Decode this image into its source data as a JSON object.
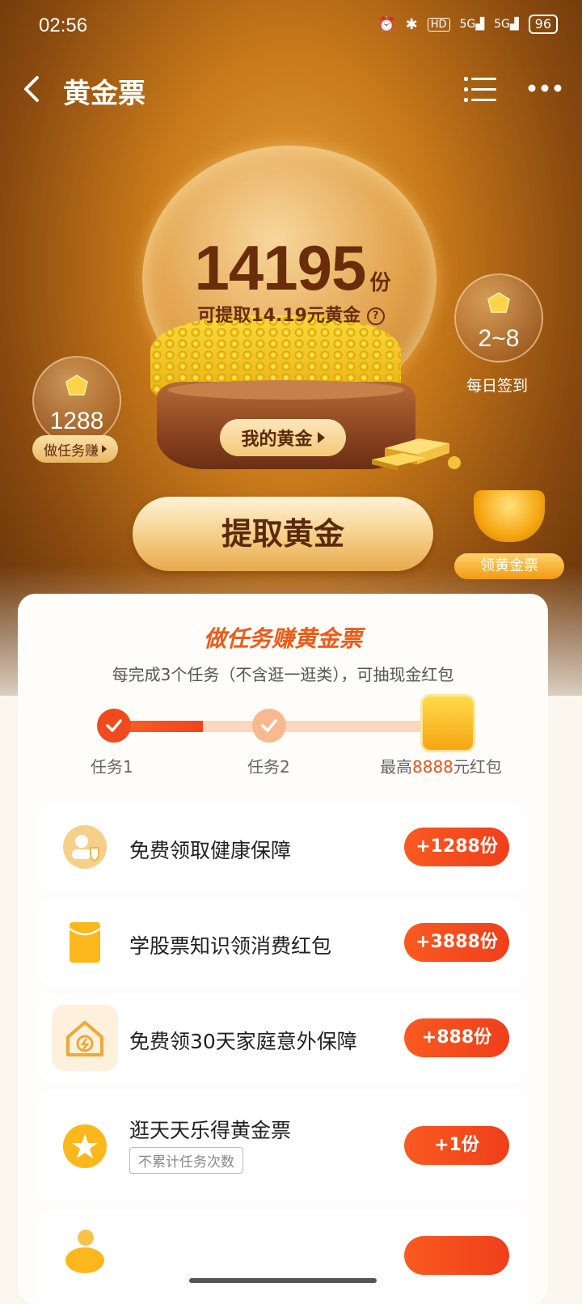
{
  "status_bar": {
    "time": "02:56",
    "hd": "HD",
    "signal1": "5G",
    "signal2": "5G",
    "battery": "96"
  },
  "nav": {
    "title": "黄金票"
  },
  "gold": {
    "amount": "14195",
    "unit": "份",
    "withdrawable": "可提取14.19元黄金",
    "help": "?",
    "my_gold_label": "我的黄金"
  },
  "bubbles": {
    "task": {
      "value": "1288",
      "label": "做任务赚"
    },
    "signin": {
      "value": "2~8",
      "label": "每日签到"
    }
  },
  "withdraw_label": "提取黄金",
  "claim_ticket_label": "领黄金票",
  "tasks_card": {
    "title": "做任务赚黄金票",
    "subtitle": "每完成3个任务（不含逛一逛类），可抽现金红包",
    "progress": {
      "completed_fraction": 0.27
    },
    "steps": [
      "任务1",
      "任务2"
    ],
    "max_prefix": "最高",
    "max_amount": "8888",
    "max_suffix": "元红包"
  },
  "tasks": [
    {
      "name": "免费领取健康保障",
      "reward": "+1288份",
      "icon": "health-shield-icon"
    },
    {
      "name": "学股票知识领消费红包",
      "reward": "+3888份",
      "icon": "red-envelope-icon"
    },
    {
      "name": "免费领30天家庭意外保障",
      "reward": "+888份",
      "icon": "house-icon"
    },
    {
      "name": "逛天天乐得黄金票",
      "tag": "不累计任务次数",
      "reward": "+1份",
      "icon": "star-icon"
    }
  ],
  "colors": {
    "accent": "#ef3f1b",
    "gold": "#f5a611",
    "brown": "#6a2d09"
  }
}
